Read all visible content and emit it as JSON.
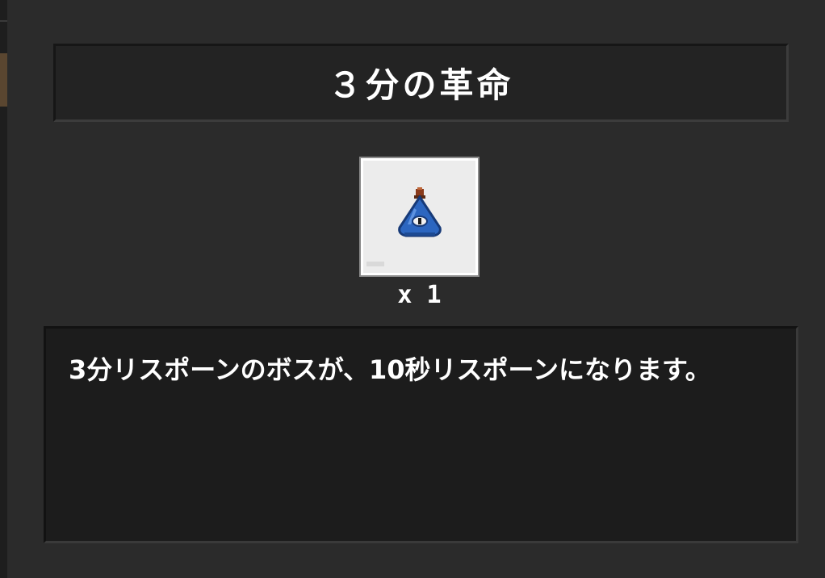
{
  "title": "３分の革命",
  "item": {
    "icon": "blue-eye-cone-hat-icon",
    "quantity_label": "x 1"
  },
  "description": "3分リスポーンのボスが、10秒リスポーンになります。",
  "colors": {
    "background": "#2b2b2b",
    "title_panel": "#232323",
    "description_panel": "#1c1c1c",
    "slot_background": "#ececec",
    "item_blue": "#2c66c0",
    "item_knob": "#8a3b1c",
    "text": "#ffffff"
  }
}
